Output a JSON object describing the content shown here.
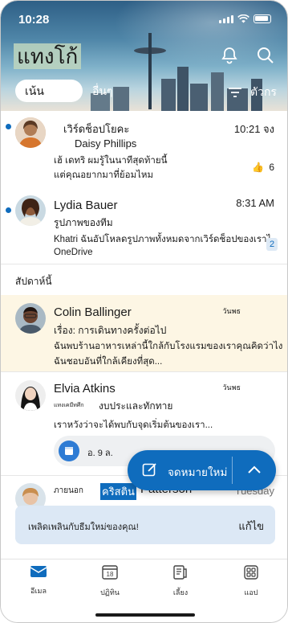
{
  "status": {
    "time": "10:28"
  },
  "header": {
    "title": "แทงโก้",
    "tab_focused": "เน้น",
    "tab_other": "อื่นๆ",
    "filter_label": "ตัวกร"
  },
  "emails": [
    {
      "sender": "เวิร์ดช็อปโยคะ",
      "subject": "Daisy Phillips",
      "preview1": "เฮ้ เดทริ ผมรู้ในนาทีสุดท้ายนี้",
      "preview2": "แต่คุณอยากมาที่ย้อมไหม",
      "time": "10:21 จง",
      "reaction_count": "6",
      "unread": true
    },
    {
      "sender": "Lydia Bauer",
      "subject": "รูปภาพของทีม",
      "preview1": "Khatri ฉันอัปโหลดรูปภาพทั้งหมดจากเวิร์ดช็อปของเราไปยัง",
      "preview2": "OneDrive",
      "time": "8:31 AM",
      "thread_count": "2",
      "unread": true
    }
  ],
  "section_label": "สัปดาห์นี้",
  "emails_week": [
    {
      "sender": "Colin Ballinger",
      "subject": "เรื่อง: การเดินทางครั้งต่อไป",
      "preview1": "ฉันพบร้านอาหารเหล่านี้ใกล้กับโรงแรมของเราคุณคิดว่าไง?",
      "preview2": "ฉันชอบอันที่ใกล้เคียงที่สุด...",
      "time": "วันพธ"
    },
    {
      "sender": "Elvia Atkins",
      "subject_prefix": "แทงเคมีทศึก",
      "subject": "งบประและทักทาย",
      "preview1": "เราหวังว่าจะได้พบกับจุดเริ่มต้นของเรา...",
      "time": "วันพธ",
      "event_date": "อ. 9 ล."
    },
    {
      "tag": "ภายนอก",
      "sender_highlight": "คริสติน",
      "sender_rest": "Patterson",
      "time": "Tuesday"
    }
  ],
  "fab": {
    "label": "จดหมายใหม่"
  },
  "banner": {
    "text": "เพลิดเพลินกับธีมใหม่ของคุณ!",
    "action": "แก้ไข"
  },
  "nav": [
    {
      "label": "อีเมล"
    },
    {
      "label": "ปฏิทิน",
      "day": "18"
    },
    {
      "label": "เลี้ยง"
    },
    {
      "label": "แอป"
    }
  ],
  "colors": {
    "accent": "#0f6cbd",
    "highlight_row": "#fdf6e4",
    "banner_bg": "#dce8f5"
  }
}
